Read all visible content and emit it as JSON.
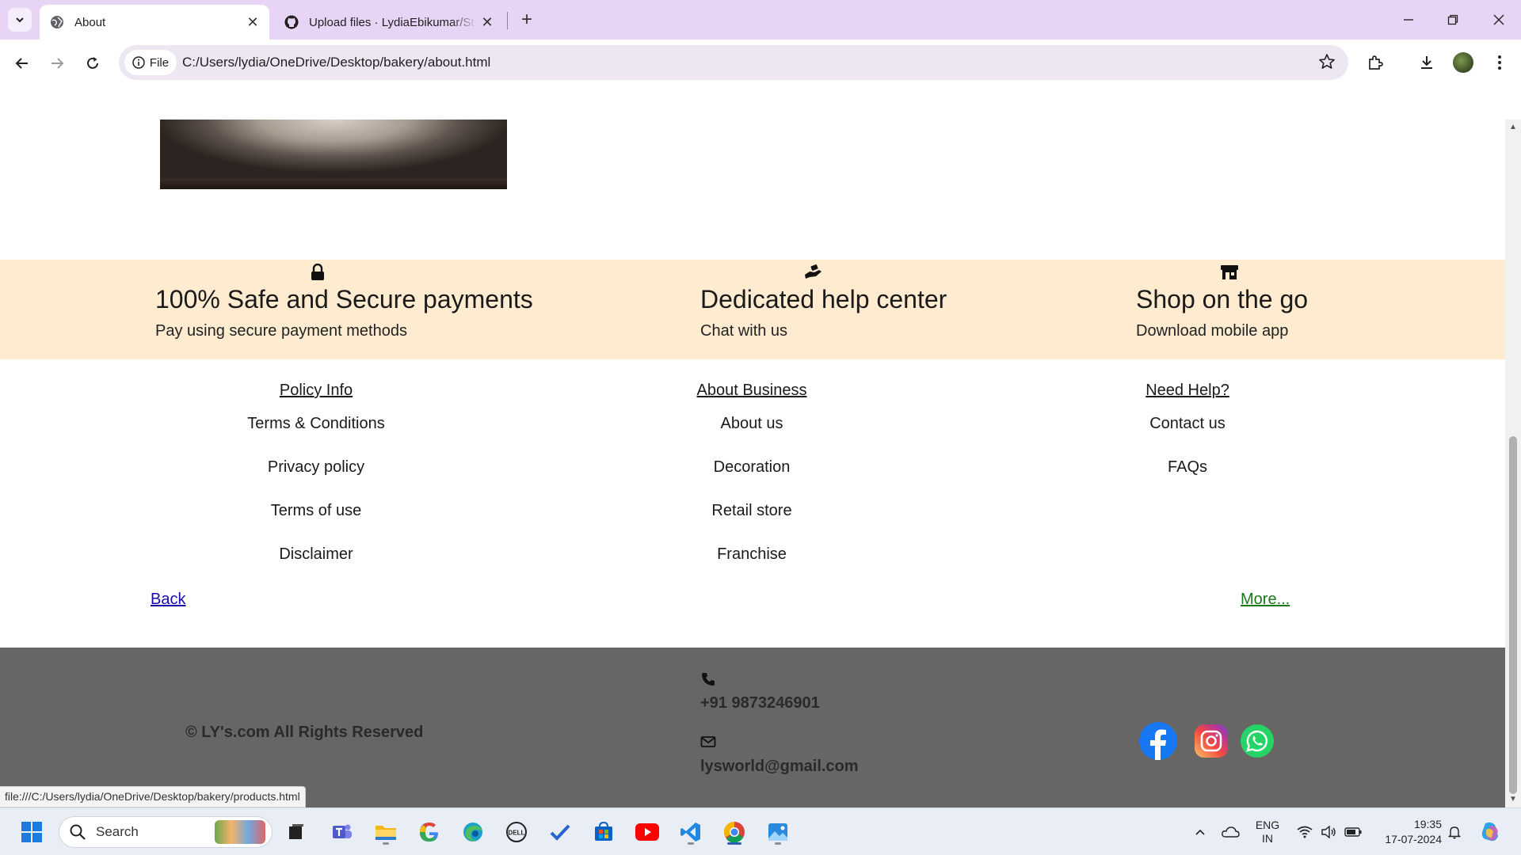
{
  "browser": {
    "tabs": [
      {
        "title": "About",
        "active": true
      },
      {
        "title": "Upload files · LydiaEbikumar/St",
        "active": false
      }
    ],
    "address": {
      "scheme_chip": "File",
      "url": "C:/Users/lydia/OneDrive/Desktop/bakery/about.html"
    }
  },
  "features": [
    {
      "icon": "lock-icon",
      "title": "100% Safe and Secure payments",
      "subtitle": "Pay using secure payment methods"
    },
    {
      "icon": "helping-hand-icon",
      "title": "Dedicated help center",
      "subtitle": "Chat with us"
    },
    {
      "icon": "store-icon",
      "title": "Shop on the go",
      "subtitle": "Download mobile app"
    }
  ],
  "footer_links": {
    "policy": {
      "heading": "Policy Info",
      "items": [
        "Terms & Conditions",
        "Privacy policy",
        "Terms of use",
        "Disclaimer"
      ]
    },
    "business": {
      "heading": "About Business",
      "items": [
        "About us",
        "Decoration",
        "Retail store",
        "Franchise"
      ]
    },
    "help": {
      "heading": "Need Help?",
      "items": [
        "Contact us",
        "FAQs"
      ]
    },
    "back": "Back",
    "more": "More..."
  },
  "footer": {
    "copyright": "© LY's.com All Rights Reserved",
    "phone": "+91 9873246901",
    "email": "lysworld@gmail.com",
    "social": [
      "facebook-icon",
      "instagram-icon",
      "whatsapp-icon"
    ]
  },
  "status_url": "file:///C:/Users/lydia/OneDrive/Desktop/bakery/products.html",
  "taskbar": {
    "search_label": "Search",
    "language": {
      "line1": "ENG",
      "line2": "IN"
    },
    "clock": {
      "time": "19:35",
      "date": "17-07-2024"
    }
  },
  "colors": {
    "features_band": "#feebd0",
    "footer_bg": "#676665",
    "back_link": "#1a0dab",
    "more_link": "#1a7a1a"
  }
}
